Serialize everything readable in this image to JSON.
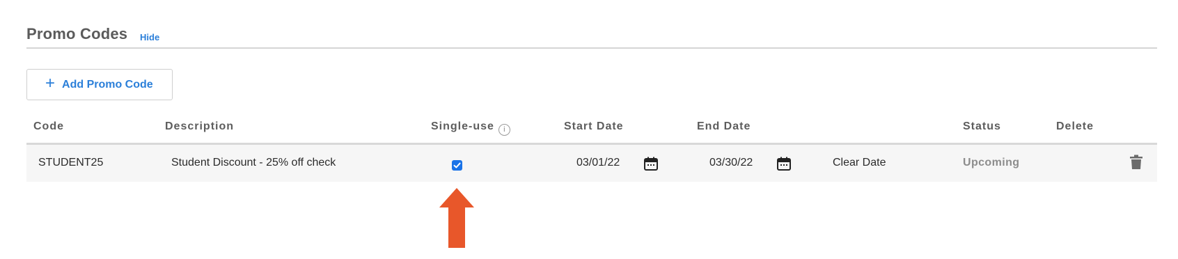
{
  "section": {
    "title": "Promo Codes",
    "hide_label": "Hide"
  },
  "toolbar": {
    "add_label": "Add Promo Code",
    "add_icon": "plus-icon"
  },
  "table": {
    "columns": {
      "code": "Code",
      "description": "Description",
      "single_use": "Single-use",
      "start_date": "Start Date",
      "end_date": "End Date",
      "status": "Status",
      "delete": "Delete"
    },
    "rows": [
      {
        "code": "STUDENT25",
        "description": "Student Discount - 25% off check",
        "single_use": true,
        "start_date": "03/01/22",
        "end_date": "03/30/22",
        "clear_date_label": "Clear Date",
        "status": "Upcoming"
      }
    ]
  },
  "colors": {
    "accent": "#2b7fd9",
    "checkbox": "#1a73e8",
    "annotation_arrow": "#e8572a",
    "status_text": "#8c8c8c"
  }
}
